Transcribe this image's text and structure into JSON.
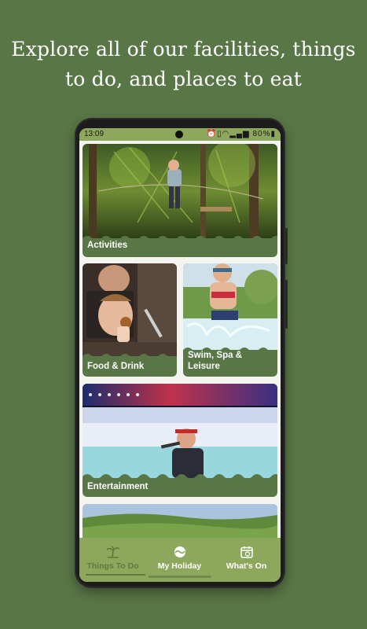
{
  "headline": {
    "line1": "Explore all of our facilities, things",
    "line2": "to do, and places to eat"
  },
  "status_bar": {
    "time": "13:09",
    "battery": "80%",
    "icons": [
      "alarm-icon",
      "vibrate-icon",
      "wifi-icon",
      "signal-icon",
      "battery-icon"
    ]
  },
  "cards": {
    "activities": "Activities",
    "food_drink": "Food & Drink",
    "swim_line1": "Swim, Spa &",
    "swim_line2": "Leisure",
    "entertainment": "Entertainment"
  },
  "nav": {
    "things_to_do": "Things To Do",
    "my_holiday": "My Holiday",
    "whats_on": "What's On",
    "active": "things_to_do"
  },
  "colors": {
    "background": "#597647",
    "card_green": "#597647",
    "nav_green": "#8da85c",
    "active_text": "#5f7a3d"
  }
}
